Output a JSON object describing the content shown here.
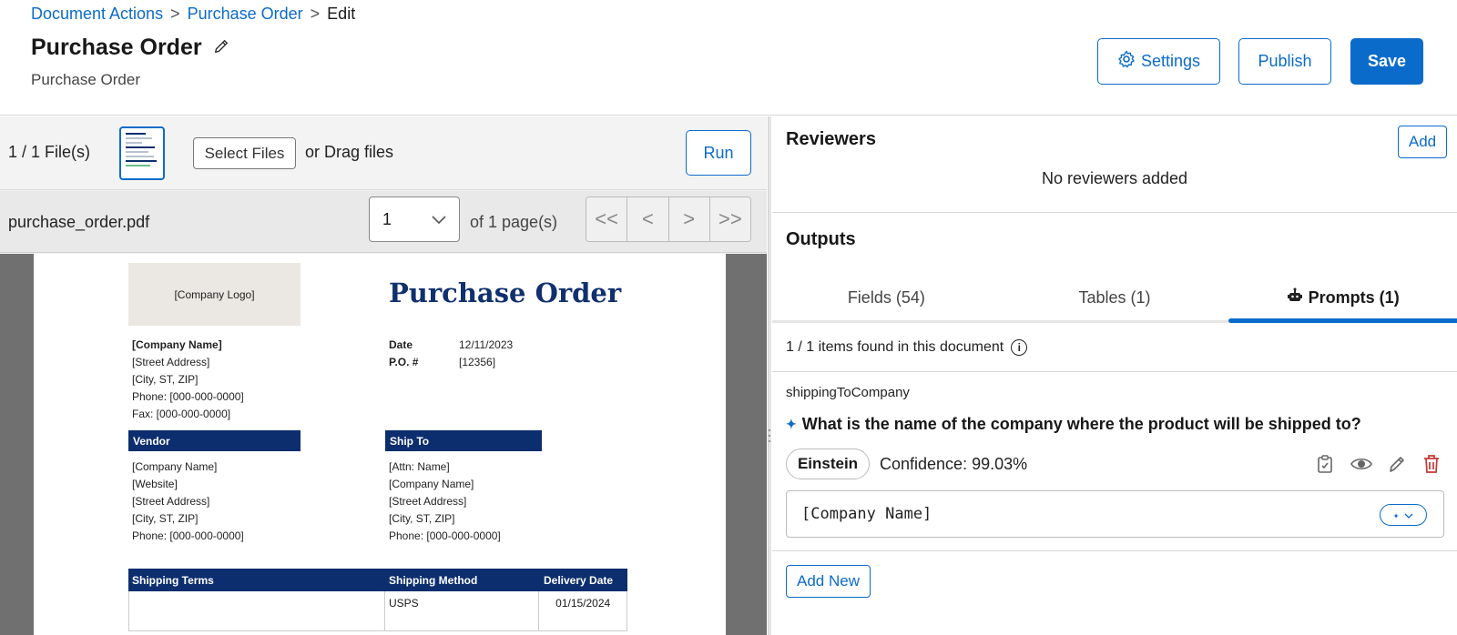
{
  "breadcrumb": {
    "items": [
      "Document Actions",
      "Purchase Order"
    ],
    "separator": ">",
    "current": "Edit"
  },
  "header": {
    "title": "Purchase Order",
    "subtitle": "Purchase Order",
    "settings_label": "Settings",
    "publish_label": "Publish",
    "save_label": "Save"
  },
  "upload": {
    "file_count": "1 / 1 File(s)",
    "select_files_label": "Select Files",
    "drag_text": "or Drag files",
    "run_label": "Run"
  },
  "pager": {
    "file_name": "purchase_order.pdf",
    "current_page": "1",
    "of_pages": "of 1 page(s)",
    "first": "<<",
    "prev": "<",
    "next": ">",
    "last": ">>"
  },
  "document": {
    "logo_text": "[Company Logo]",
    "title": "Purchase Order",
    "company": {
      "name": "[Company Name]",
      "street": "[Street Address]",
      "city": "[City, ST, ZIP]",
      "phone": "Phone: [000-000-0000]",
      "fax": "Fax: [000-000-0000]"
    },
    "date_label": "Date",
    "date_value": "12/11/2023",
    "po_label": "P.O. #",
    "po_value": "[12356]",
    "vendor_heading": "Vendor",
    "vendor": {
      "name": "[Company Name]",
      "website": "[Website]",
      "street": "[Street Address]",
      "city": "[City, ST, ZIP]",
      "phone": "Phone: [000-000-0000]"
    },
    "ship_to_heading": "Ship To",
    "ship_to": {
      "attn": "[Attn: Name]",
      "name": "[Company Name]",
      "street": "[Street Address]",
      "city": "[City, ST, ZIP]",
      "phone": "Phone: [000-000-0000]"
    },
    "shipping_headers": [
      "Shipping Terms",
      "Shipping Method",
      "Delivery Date"
    ],
    "shipping_row": [
      "",
      "USPS",
      "01/15/2024"
    ]
  },
  "reviewers": {
    "title": "Reviewers",
    "add_label": "Add",
    "empty_text": "No reviewers added"
  },
  "outputs": {
    "title": "Outputs",
    "tabs": [
      {
        "label": "Fields (54)",
        "active": false
      },
      {
        "label": "Tables (1)",
        "active": false
      },
      {
        "label": "Prompts (1)",
        "active": true,
        "icon": "robot-icon"
      }
    ],
    "items_found": "1 / 1 items found in this document",
    "prompt": {
      "key": "shippingToCompany",
      "question": "What is the name of the company where the product will be shipped to?",
      "source": "Einstein",
      "confidence": "Confidence: 99.03%",
      "value": "[Company Name]"
    },
    "add_new_label": "Add New"
  },
  "colors": {
    "brand": "#0b6bcb",
    "navy": "#0d2e6e",
    "delete": "#c23934"
  }
}
